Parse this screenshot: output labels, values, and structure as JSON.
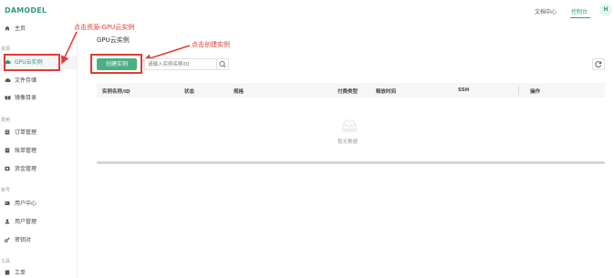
{
  "header": {
    "logo": "DAMODEL",
    "nav_doc": "文档中心",
    "nav_console": "控制台",
    "avatar_letter": "H"
  },
  "sidebar": {
    "home": "主页",
    "group_resources": "资源",
    "gpu_instance": "GPU云实例",
    "file_storage": "文件存储",
    "image_dir": "镜像目录",
    "group_billing": "费用",
    "order_mgmt": "订单管理",
    "bill_mgmt": "账单管理",
    "fund_mgmt": "资金管理",
    "group_account": "账号",
    "user_center": "用户中心",
    "user_mgmt": "用户管理",
    "keys": "密钥对",
    "group_tools": "工具",
    "tools": "工单"
  },
  "annotations": {
    "sidebar_hint": "点击资源-GPU云实例",
    "create_hint": "点击创建实例",
    "color": "#e53935"
  },
  "main": {
    "title": "GPU云实例",
    "create_button": "创建实例",
    "search_placeholder": "请输入实例名称/ID",
    "columns": [
      "实例名称/ID",
      "状态",
      "规格",
      "付费类型",
      "释放时间",
      "SSH",
      "操作"
    ],
    "empty_text": "暂无数据"
  },
  "colors": {
    "accent": "#2e9e78",
    "button": "#4caf84",
    "annotation": "#e53935"
  }
}
